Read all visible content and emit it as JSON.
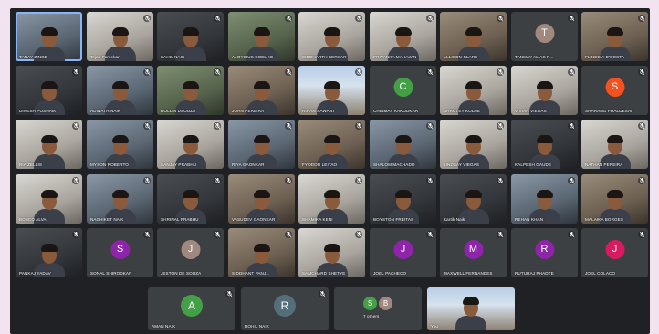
{
  "colors": {
    "page_bg": "#f1e3ef",
    "meeting_bg": "#1f2124",
    "tile_bg": "#3c4043",
    "active_border": "#8ab4f8"
  },
  "participants": [
    {
      "name": "TANAY ZINGE",
      "type": "video",
      "tone": "photo-cool",
      "active": true
    },
    {
      "name": "Tejas Parsekar",
      "type": "video",
      "tone": "photo-light"
    },
    {
      "name": "SAHIL NAIK",
      "type": "video",
      "tone": "photo-dark"
    },
    {
      "name": "ALOYSIUS COELHO",
      "type": "video",
      "tone": "photo-green"
    },
    {
      "name": "SIDDHARTH KERKAR",
      "type": "video",
      "tone": "photo-light"
    },
    {
      "name": "PRIYANKA MAHAJAN",
      "type": "video",
      "tone": "photo-light"
    },
    {
      "name": "ALLISON CLARE",
      "type": "video",
      "tone": "photo-warm"
    },
    {
      "name": "TANMAY ALIAS R...",
      "type": "avatar",
      "initial": "T",
      "color": "#a1887f"
    },
    {
      "name": "FLINECIA D'COSTA",
      "type": "video",
      "tone": "photo-warm"
    },
    {
      "name": "DINESH POSHAIK",
      "type": "video",
      "tone": "photo-dark"
    },
    {
      "name": "ADINATH NAIK",
      "type": "video",
      "tone": "photo-cool"
    },
    {
      "name": "ROLLIN DSOUZA",
      "type": "video",
      "tone": "photo-green"
    },
    {
      "name": "JOHN PEREIRA",
      "type": "video",
      "tone": "photo-warm"
    },
    {
      "name": "RIHAN SAWANT",
      "type": "video",
      "tone": "photo-sky"
    },
    {
      "name": "CHINMAY KAKODKAR",
      "type": "avatar",
      "initial": "C",
      "color": "#43a047"
    },
    {
      "name": "SHRUTEY KOLHE",
      "type": "video",
      "tone": "photo-light"
    },
    {
      "name": "VIVIAN VIEGAS",
      "type": "video",
      "tone": "photo-light"
    },
    {
      "name": "SHARANG PHALDESAI",
      "type": "avatar",
      "initial": "S",
      "color": "#f4511e"
    },
    {
      "name": "RIA ZELLIS",
      "type": "video",
      "tone": "photo-light"
    },
    {
      "name": "MYSON ROBERTO",
      "type": "video",
      "tone": "photo-cool"
    },
    {
      "name": "SANJAY PRABHU",
      "type": "video",
      "tone": "photo-light"
    },
    {
      "name": "RIYA GAONKAR",
      "type": "video",
      "tone": "photo-cool"
    },
    {
      "name": "FYODOR LEITAO",
      "type": "video",
      "tone": "photo-warm"
    },
    {
      "name": "SHALOM MACHADO",
      "type": "video",
      "tone": "photo-cool"
    },
    {
      "name": "LINDSAY VIEGAS",
      "type": "video",
      "tone": "photo-light"
    },
    {
      "name": "KALPESH GAUDE",
      "type": "video",
      "tone": "photo-dark"
    },
    {
      "name": "NATHAN PEREIRA",
      "type": "video",
      "tone": "photo-light"
    },
    {
      "name": "BOSCO ALVA",
      "type": "video",
      "tone": "photo-light"
    },
    {
      "name": "NACHIKET NAIK",
      "type": "video",
      "tone": "photo-cool"
    },
    {
      "name": "SHRINAL PRABHU",
      "type": "video",
      "tone": "photo-dark"
    },
    {
      "name": "VASUDEV GAONKAR",
      "type": "video",
      "tone": "photo-warm"
    },
    {
      "name": "SHAMIKA KENI",
      "type": "video",
      "tone": "photo-light"
    },
    {
      "name": "BOYSTON FREITAS",
      "type": "video",
      "tone": "photo-dark"
    },
    {
      "name": "Kartik Naik",
      "type": "video",
      "tone": "photo-dark"
    },
    {
      "name": "REHAN KHAN",
      "type": "video",
      "tone": "photo-cool"
    },
    {
      "name": "MALAIKA BORGES",
      "type": "video",
      "tone": "photo-warm"
    },
    {
      "name": "PANKAJ YADAV",
      "type": "video",
      "tone": "photo-dark"
    },
    {
      "name": "SONAL SHIRODKAR",
      "type": "avatar",
      "initial": "S",
      "color": "#8e24aa"
    },
    {
      "name": "JESTON DE SOUZA",
      "type": "avatar",
      "initial": "J",
      "color": "#a1887f"
    },
    {
      "name": "SIDDHANT PANJ...",
      "type": "video",
      "tone": "photo-warm"
    },
    {
      "name": "SAMCHARD SHETYE",
      "type": "video",
      "tone": "photo-light"
    },
    {
      "name": "JOEL PACHECO",
      "type": "avatar",
      "initial": "J",
      "color": "#8e24aa"
    },
    {
      "name": "MAXWELL FERNANDES",
      "type": "avatar",
      "initial": "M",
      "color": "#8e24aa"
    },
    {
      "name": "RUTURAJ PHADTE",
      "type": "avatar",
      "initial": "R",
      "color": "#8e24aa"
    },
    {
      "name": "JOEL COLACO",
      "type": "avatar",
      "initial": "J",
      "color": "#d81b60"
    }
  ],
  "bottom_row": [
    {
      "name": "AMAN NAIK",
      "type": "avatar",
      "initial": "A",
      "color": "#43a047"
    },
    {
      "name": "ROHIL NAIK",
      "type": "avatar",
      "initial": "R",
      "color": "#546e7a"
    },
    {
      "name": "7 others",
      "type": "others",
      "initials": [
        {
          "letter": "S",
          "color": "#43a047"
        },
        {
          "letter": "B",
          "color": "#a1887f"
        }
      ]
    },
    {
      "name": "You",
      "type": "video",
      "tone": "photo-sky"
    }
  ]
}
